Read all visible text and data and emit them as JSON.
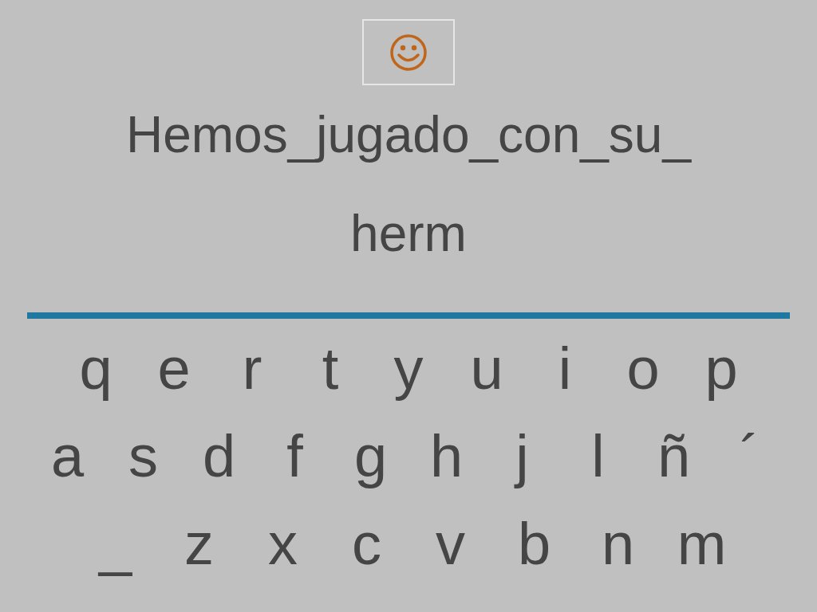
{
  "phrase_lines": [
    "Hemos_jugado_con_su_",
    "herm"
  ],
  "keyboard": {
    "rows": [
      [
        "q",
        "e",
        "r",
        "t",
        "y",
        "u",
        "i",
        "o",
        "p"
      ],
      [
        "a",
        "s",
        "d",
        "f",
        "g",
        "h",
        "j",
        "l",
        "ñ",
        "´"
      ],
      [
        "_",
        "z",
        "x",
        "c",
        "v",
        "b",
        "n",
        "m"
      ]
    ]
  }
}
